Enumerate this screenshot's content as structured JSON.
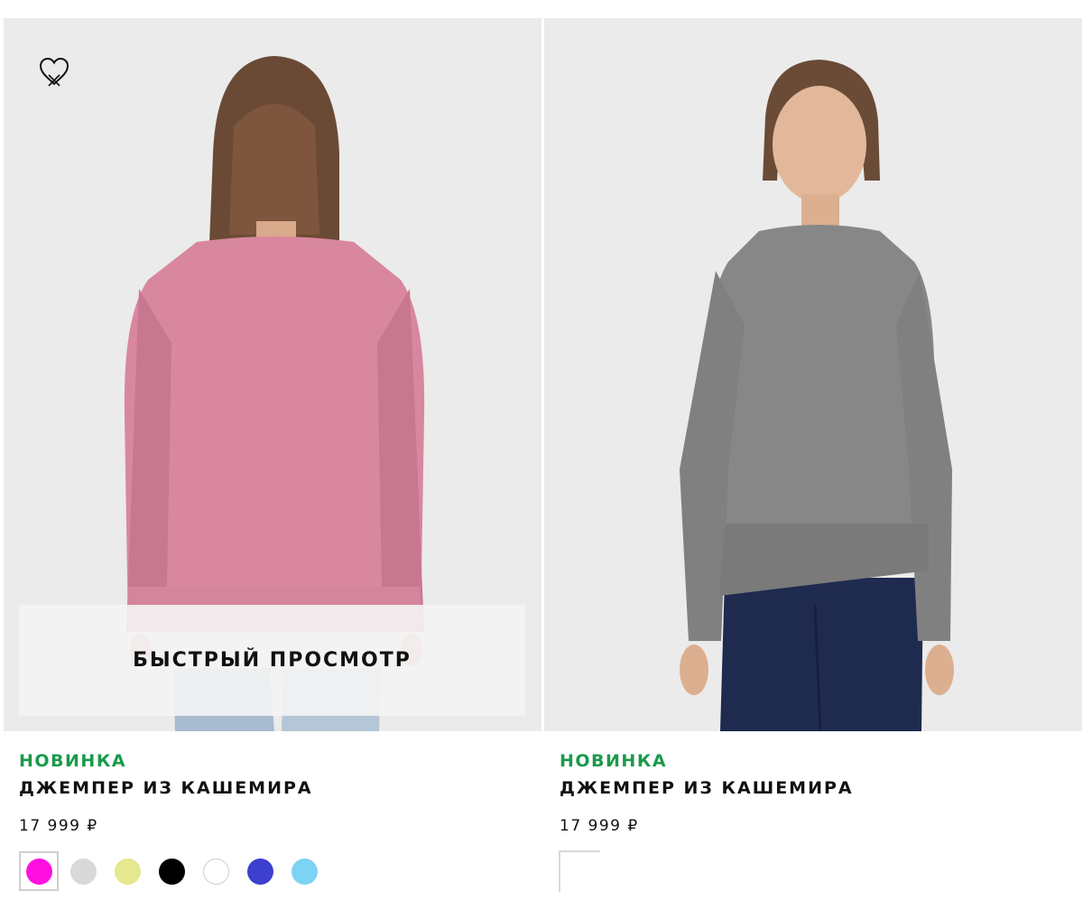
{
  "products": [
    {
      "badge": "НОВИНКА",
      "title": "ДЖЕМПЕР ИЗ КАШЕМИРА",
      "price": "17 999 ₽",
      "quick_view_label": "БЫСТРЫЙ ПРОСМОТР",
      "wishlist_icon": "heart-outline-icon",
      "image_desc": "pink-sweater-back-view",
      "swatches": [
        {
          "color": "#ff10e0",
          "selected": true
        },
        {
          "color": "#d9d9d9",
          "selected": false
        },
        {
          "color": "#e4e88e",
          "selected": false
        },
        {
          "color": "#000000",
          "selected": false
        },
        {
          "color": "#ffffff",
          "selected": false
        },
        {
          "color": "#3d3fcf",
          "selected": false
        },
        {
          "color": "#7dd3f3",
          "selected": false
        }
      ]
    },
    {
      "badge": "НОВИНКА",
      "title": "ДЖЕМПЕР ИЗ КАШЕМИРА",
      "price": "17 999 ₽",
      "image_desc": "grey-sweater-front-view",
      "swatches": []
    }
  ],
  "colors": {
    "badge_green": "#1a9a4b",
    "photo_bg": "#ebebeb"
  }
}
